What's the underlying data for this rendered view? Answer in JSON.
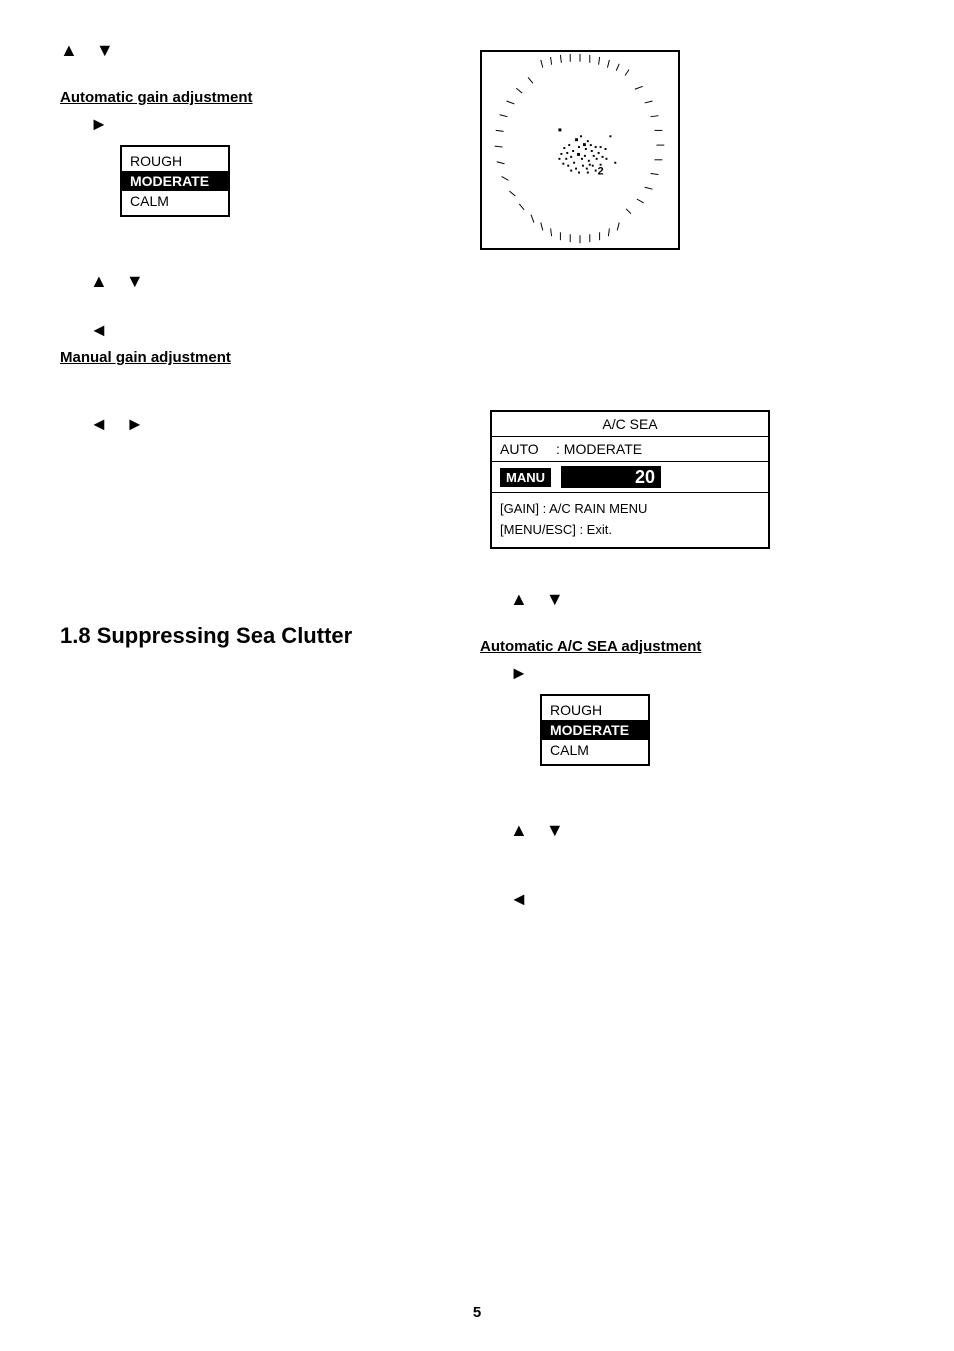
{
  "page": {
    "number": "5"
  },
  "left": {
    "top_arrows": "▲   ▼",
    "auto_gain_heading": "Automatic gain adjustment",
    "arrow_right_1": "►",
    "menu1": {
      "items": [
        "ROUGH",
        "MODERATE",
        "CALM"
      ],
      "selected": "MODERATE"
    },
    "arrows_2": "▲   ▼",
    "arrow_left_1": "◄",
    "manual_gain_heading": "Manual gain adjustment",
    "arrows_3": "◄   ►",
    "section_18": "1.8  Suppressing Sea Clutter"
  },
  "right": {
    "ac_sea_panel": {
      "title": "A/C SEA",
      "auto_label": "AUTO",
      "auto_value": ": MODERATE",
      "manu_label": "MANU",
      "manu_value": "20",
      "footer_line1": "[GAIN]  :  A/C RAIN MENU",
      "footer_line2": "[MENU/ESC]  :  Exit."
    },
    "arrows_top": "▲   ▼",
    "auto_ac_sea_heading": "Automatic A/C SEA adjustment",
    "arrow_right_2": "►",
    "menu2": {
      "items": [
        "ROUGH",
        "MODERATE",
        "CALM"
      ],
      "selected": "MODERATE"
    },
    "arrows_bottom": "▲   ▼",
    "arrow_left_2": "◄"
  }
}
